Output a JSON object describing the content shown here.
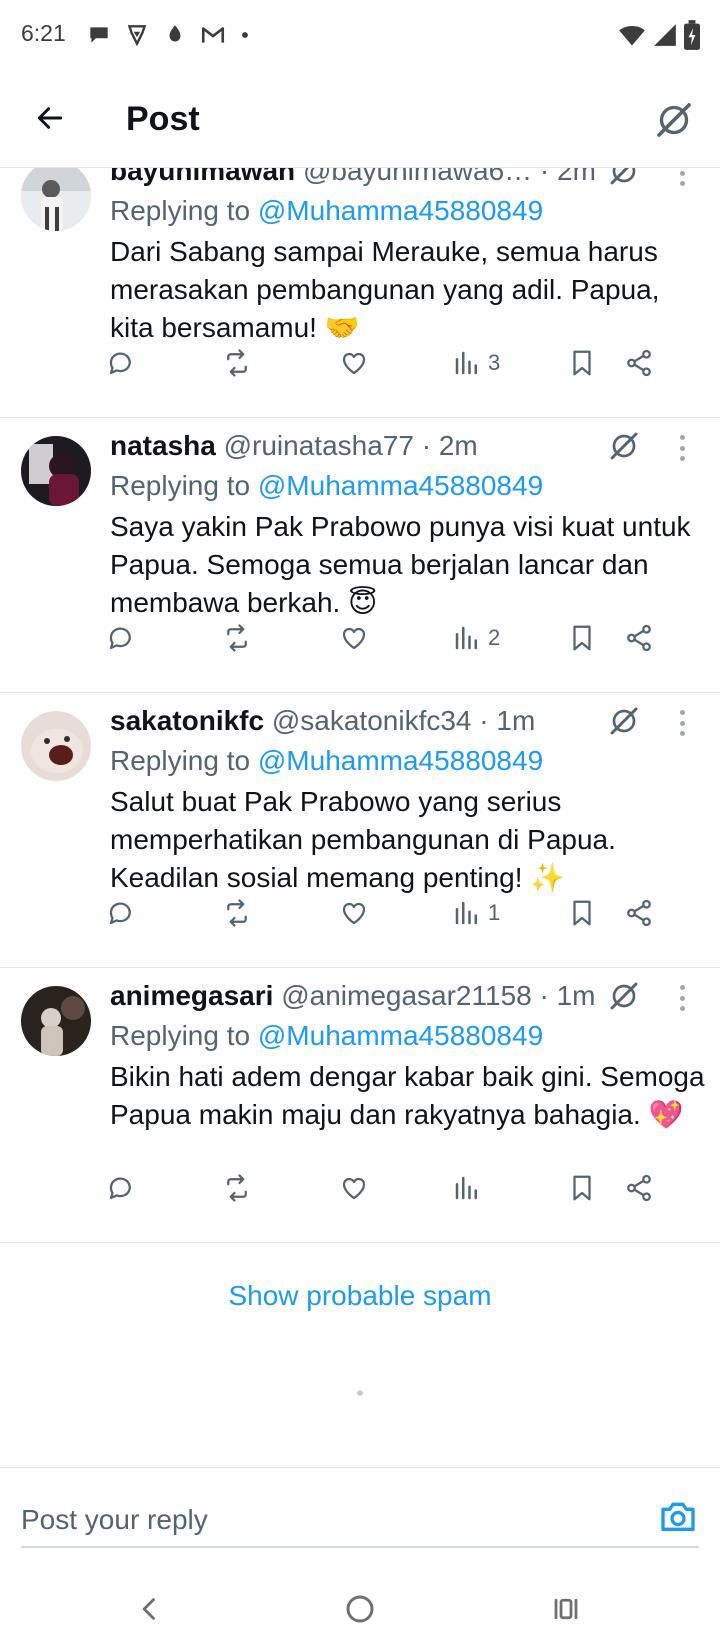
{
  "status_bar": {
    "time": "6:21",
    "left_icons": [
      "chat-bubble-icon",
      "brave-icon",
      "shield-flame-icon",
      "gmail-icon",
      "dot-icon"
    ],
    "right_icons": [
      "wifi-icon",
      "cell-signal-icon",
      "battery-icon"
    ]
  },
  "header": {
    "title": "Post",
    "back_icon": "arrow-left-icon",
    "grok_icon": "grok-icon"
  },
  "replies": [
    {
      "display_name": "bayunimawan",
      "handle_time": "@bayunimawa6…  · 2m",
      "replying_prefix": "Replying to",
      "mention": "@Muhamma45880849",
      "text": "Dari Sabang sampai Merauke, semua harus merasakan pembangunan yang adil. Papua, kita bersamamu! 🤝",
      "views": "3"
    },
    {
      "display_name": "natasha",
      "handle_time": "@ruinatasha77 · 2m",
      "replying_prefix": "Replying to",
      "mention": "@Muhamma45880849",
      "text": "Saya yakin Pak Prabowo punya visi kuat untuk Papua. Semoga semua berjalan lancar dan membawa berkah. 😇",
      "views": "2"
    },
    {
      "display_name": "sakatonikfc",
      "handle_time": "@sakatonikfc34 · 1m",
      "replying_prefix": "Replying to",
      "mention": "@Muhamma45880849",
      "text": "Salut buat Pak Prabowo yang serius memperhatikan pembangunan di Papua. Keadilan sosial memang penting! ✨",
      "views": "1"
    },
    {
      "display_name": "animegasari",
      "handle_time": "@animegasar21158 · 1m",
      "replying_prefix": "Replying to",
      "mention": "@Muhamma45880849",
      "text": "Bikin hati adem dengar kabar baik gini. Semoga Papua makin maju dan rakyatnya bahagia. 💖",
      "views": ""
    }
  ],
  "spam_link": "Show probable spam",
  "reply_bar": {
    "placeholder": "Post your reply",
    "camera_icon": "camera-icon"
  },
  "colors": {
    "accent": "#1d9bf0",
    "text_primary": "#0f1419",
    "text_secondary": "#536471",
    "divider": "#e6e8ea"
  }
}
